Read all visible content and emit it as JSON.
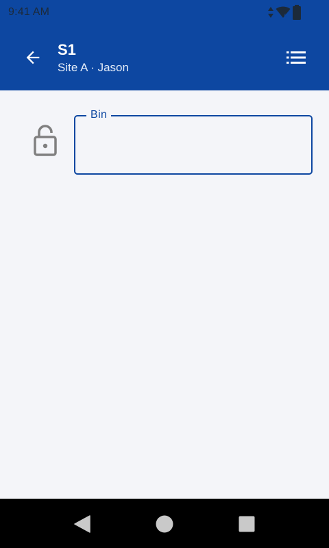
{
  "status_bar": {
    "time": "9:41 AM",
    "icons": [
      "data-arrows-icon",
      "wifi-icon",
      "battery-icon"
    ]
  },
  "app_bar": {
    "title": "S1",
    "subtitle": "Site A · Jason",
    "back_icon": "arrow-back-icon",
    "menu_icon": "list-icon"
  },
  "form": {
    "lock_icon": "lock-open-icon",
    "bin_field": {
      "label": "Bin",
      "value": "",
      "placeholder": ""
    }
  },
  "nav_bar": {
    "buttons": [
      "back",
      "home",
      "recents"
    ]
  },
  "colors": {
    "primary": "#0d47a1",
    "background": "#f4f5f9",
    "icon_gray": "#808080",
    "navbar": "#000000"
  }
}
